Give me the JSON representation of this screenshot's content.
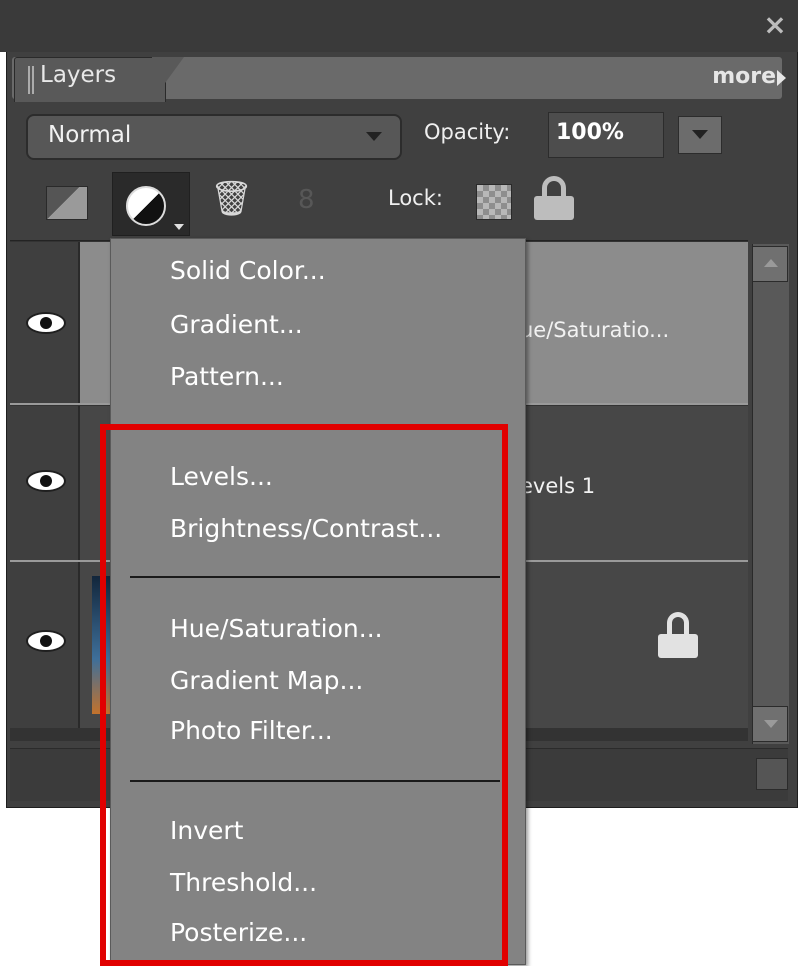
{
  "panel": {
    "tab_label": "Layers",
    "more_label": "more",
    "close_glyph": "×"
  },
  "blend": {
    "value": "Normal"
  },
  "opacity": {
    "label": "Opacity:",
    "value": "100%"
  },
  "lock": {
    "label": "Lock:"
  },
  "icons": {
    "trash": "🗑",
    "link": "8"
  },
  "layers": [
    {
      "name": "ue/Saturatio..."
    },
    {
      "name": "evels 1"
    },
    {
      "name": ""
    }
  ],
  "menu": {
    "groups": [
      [
        "Solid Color...",
        "Gradient...",
        "Pattern..."
      ],
      [
        "Levels...",
        "Brightness/Contrast..."
      ],
      [
        "Hue/Saturation...",
        "Gradient Map...",
        "Photo Filter..."
      ],
      [
        "Invert",
        "Threshold...",
        "Posterize..."
      ]
    ]
  },
  "colors": {
    "panel_bg": "#404040",
    "menu_bg": "#838383",
    "highlight": "#e10000",
    "selected_row": "#8c8c8c"
  }
}
